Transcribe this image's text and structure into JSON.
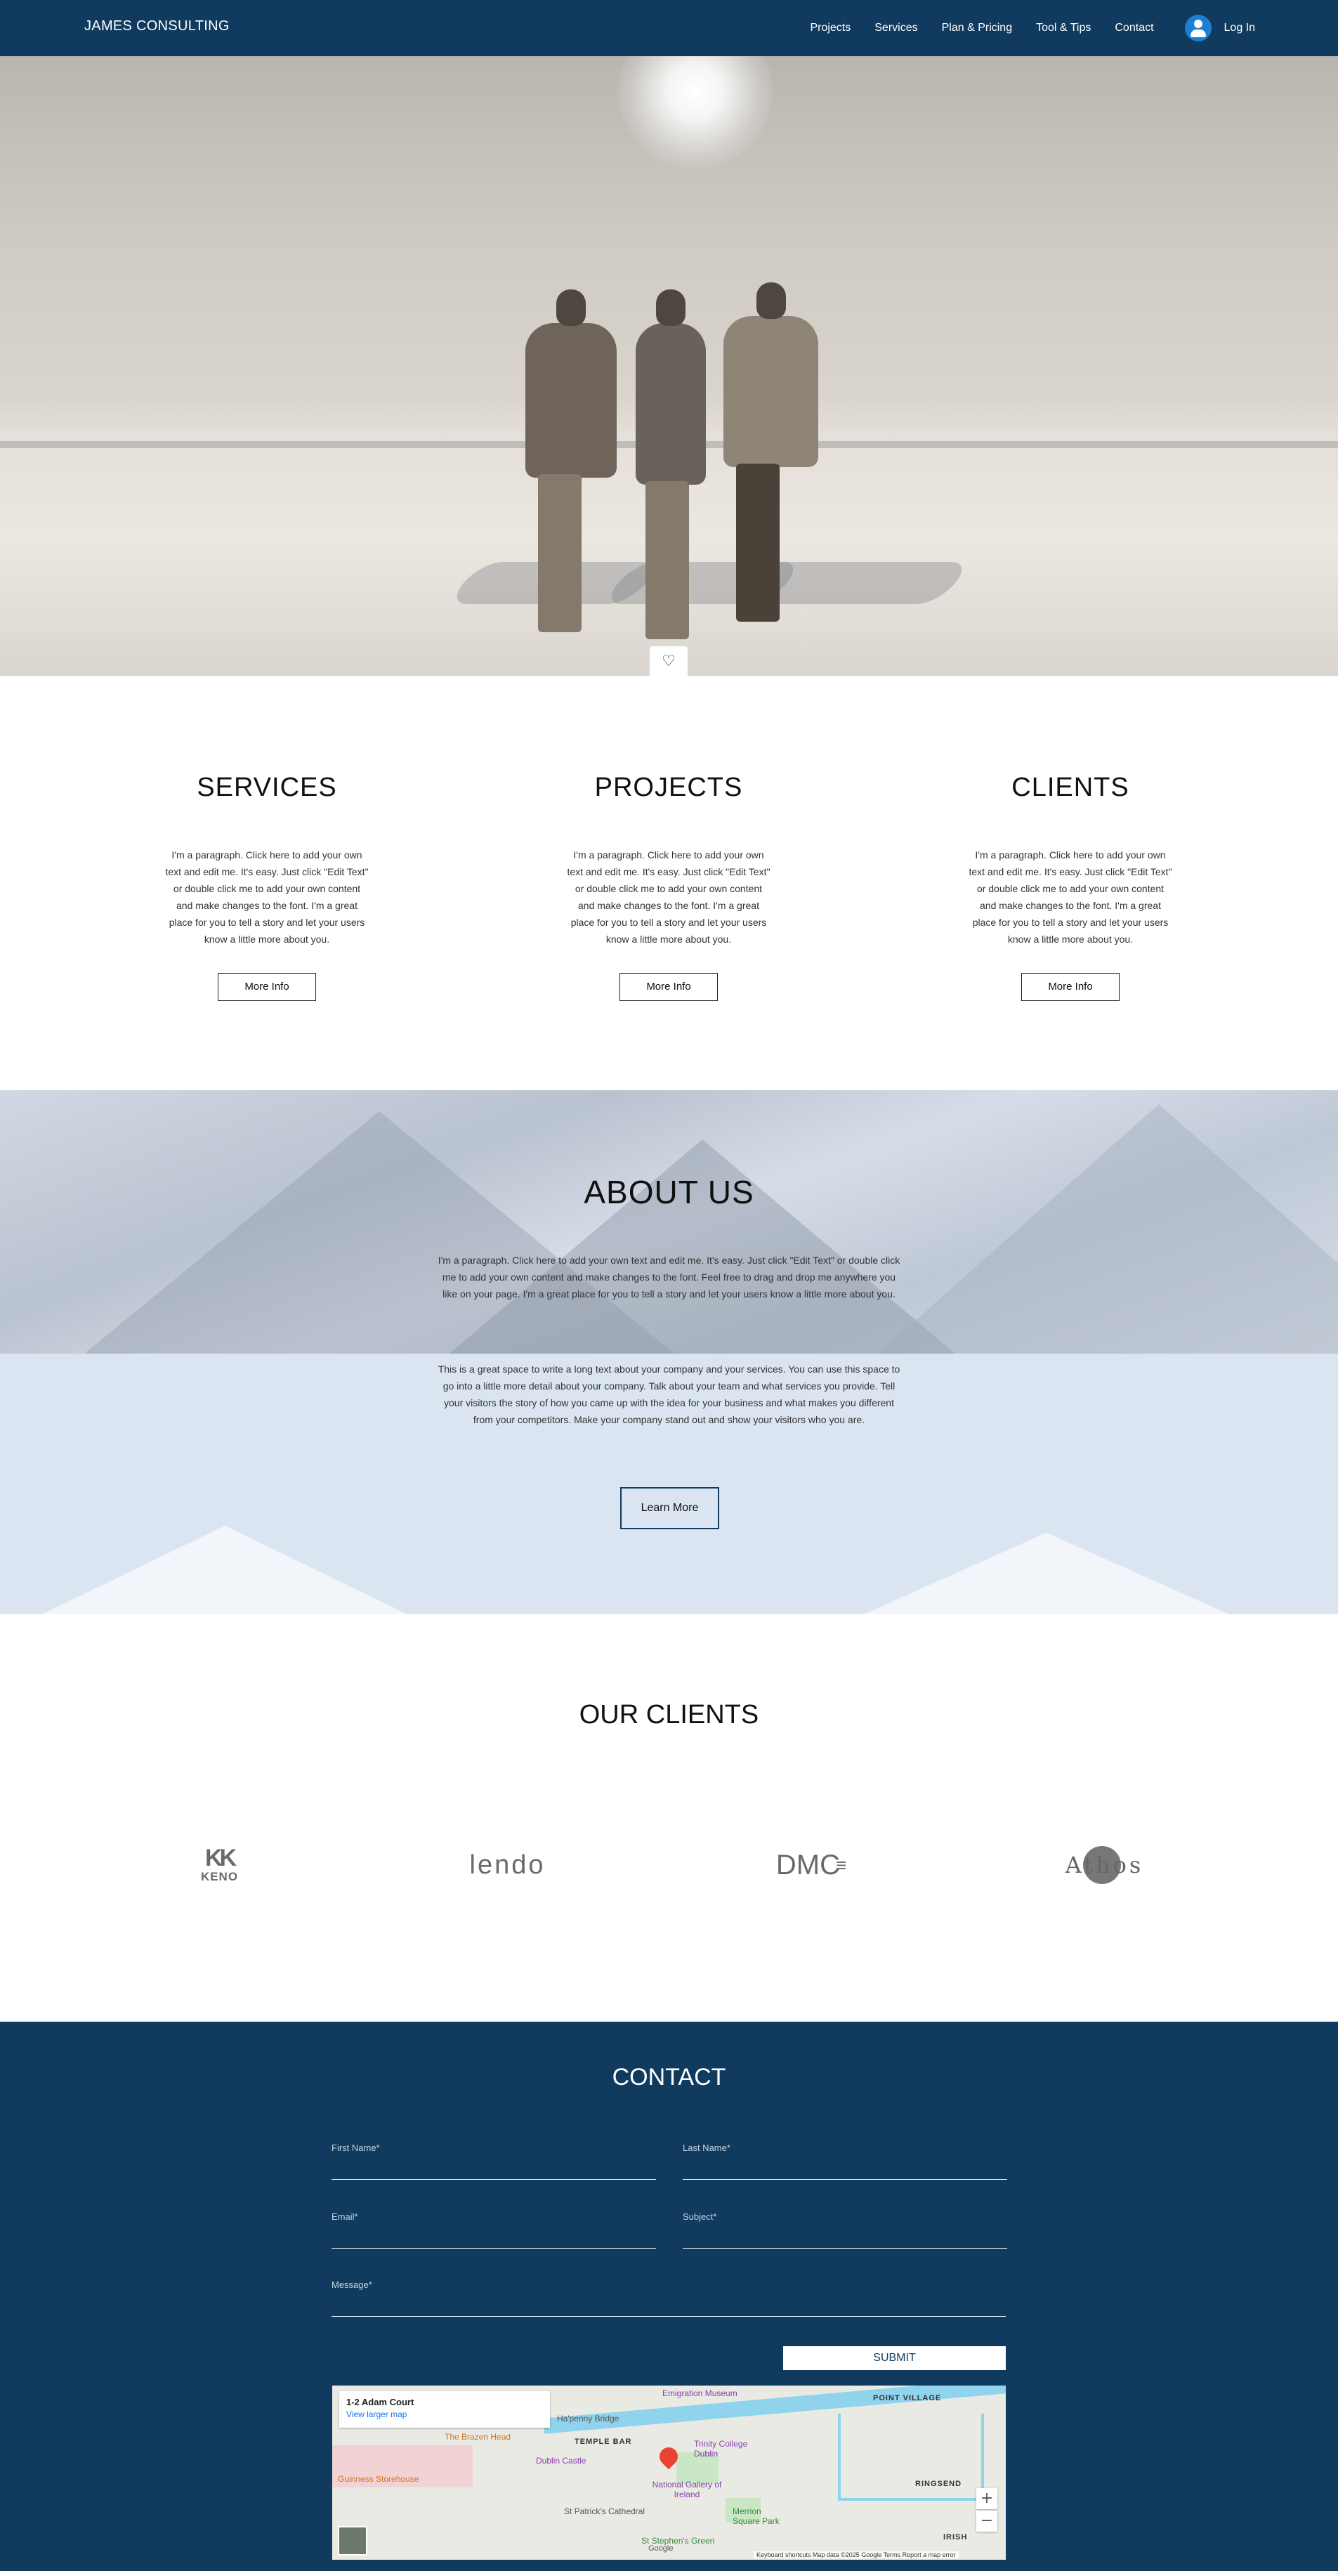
{
  "header": {
    "brand": "JAMES CONSULTING",
    "nav": [
      "Projects",
      "Services",
      "Plan & Pricing",
      "Tool & Tips",
      "Contact"
    ],
    "login_label": "Log In"
  },
  "hero": {
    "scroll_icon": "heart-icon"
  },
  "sections": [
    {
      "title": "SERVICES",
      "text": "I'm a paragraph. Click here to add your own text and edit me. It's easy. Just click \"Edit Text\" or double click me to add your own content and make changes to the font. I'm a great place for you to tell a story and let your users know a little more about you.",
      "button": "More Info"
    },
    {
      "title": "PROJECTS",
      "text": "I'm a paragraph. Click here to add your own text and edit me. It's easy. Just click \"Edit Text\" or double click me to add your own content and make changes to the font. I'm a great place for you to tell a story and let your users know a little more about you.",
      "button": "More Info"
    },
    {
      "title": "CLIENTS",
      "text": "I'm a paragraph. Click here to add your own text and edit me. It's easy. Just click \"Edit Text\" or double click me to add your own content and make changes to the font. I'm a great place for you to tell a story and let your users know a little more about you.",
      "button": "More Info"
    }
  ],
  "about": {
    "title": "ABOUT US",
    "paragraph1": "I'm a paragraph. Click here to add your own text and edit me. It's easy. Just click \"Edit Text\" or double click me to add your own content and make changes to the font. Feel free to drag and drop me anywhere you like on your page. I'm a great place for you to tell a story and let your users know a little more about you.",
    "paragraph2": "This is a great space to write a long text about your company and your services. You can use this space to go into a little more detail about your company. Talk about your team and what services you provide. Tell your visitors the story of how you came up with the idea for your business and what makes you different from your competitors. Make your company stand out and show your visitors who you are.",
    "button": "Learn More"
  },
  "clients": {
    "title": "OUR CLIENTS",
    "logos": [
      {
        "top": "KK",
        "bottom": "KENO"
      },
      {
        "text": "lendo"
      },
      {
        "text": "DMC"
      },
      {
        "text": "Athos"
      }
    ]
  },
  "contact": {
    "title": "CONTACT",
    "fields": {
      "first_name": "First Name*",
      "last_name": "Last Name*",
      "email": "Email*",
      "subject": "Subject*",
      "message": "Message*"
    },
    "submit": "SUBMIT"
  },
  "map": {
    "address": "1-2 Adam Court",
    "link": "View larger map",
    "labels": {
      "emigration": "Emigration Museum",
      "point_village": "POINT VILLAGE",
      "brazen_head": "The Brazen Head",
      "hapenny": "Ha'penny Bridge",
      "temple_bar": "TEMPLE BAR",
      "trinity": "Trinity College Dublin",
      "dublin_castle": "Dublin Castle",
      "guinness": "Guinness Storehouse",
      "national_gallery": "National Gallery of Ireland",
      "ringsend": "RINGSEND",
      "st_patricks": "St Patrick's Cathedral",
      "merrion": "Merrion Square Park",
      "irish": "IRISH",
      "st_stephens": "St Stephen's Green",
      "google": "Google"
    },
    "footer": "Keyboard shortcuts   Map data ©2025 Google   Terms   Report a map error",
    "zoom_in": "+",
    "zoom_out": "−"
  }
}
